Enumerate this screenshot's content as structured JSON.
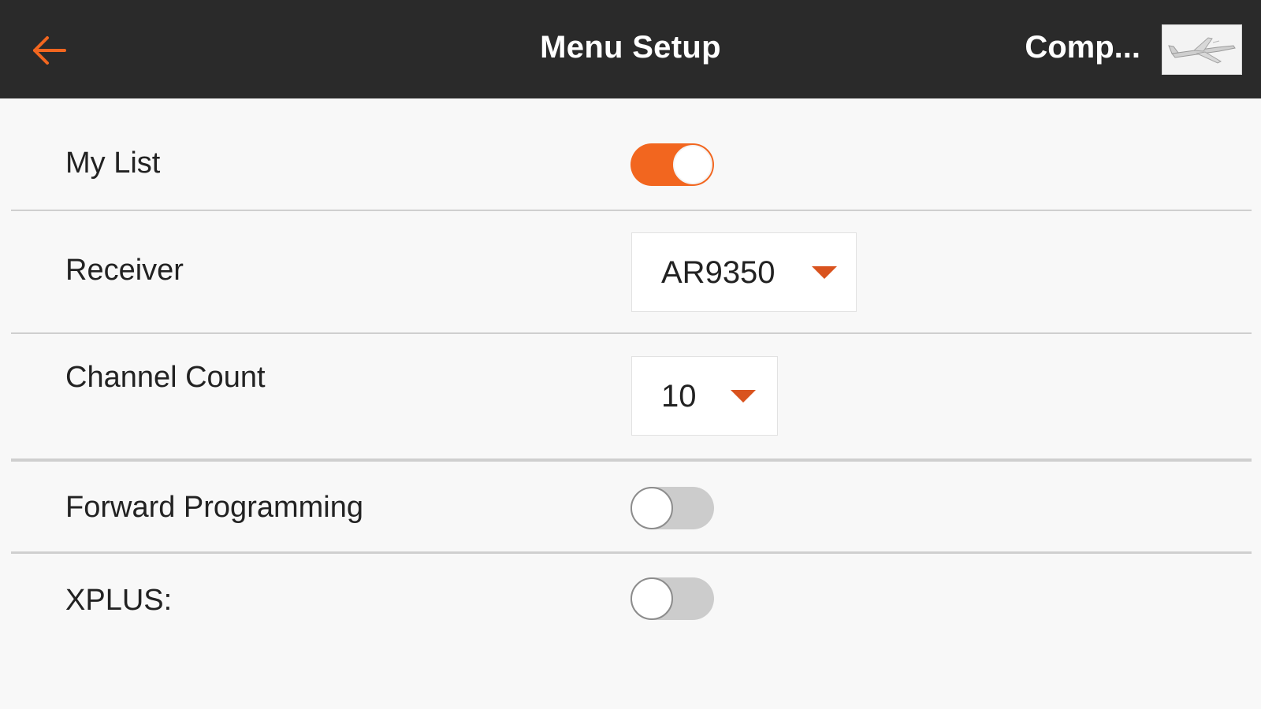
{
  "header": {
    "title": "Menu Setup",
    "model_name": "Comp...",
    "back_icon": "arrow-left-icon",
    "thumbnail_icon": "airplane-thumbnail-icon"
  },
  "colors": {
    "header_bg": "#2a2a2a",
    "accent": "#f2661f",
    "caret": "#d9531e",
    "background": "#f8f8f8"
  },
  "rows": {
    "my_list": {
      "label": "My List",
      "enabled": true
    },
    "receiver": {
      "label": "Receiver",
      "value": "AR9350"
    },
    "channel_count": {
      "label": "Channel Count",
      "value": "10"
    },
    "forward_programming": {
      "label": "Forward Programming",
      "enabled": false
    },
    "xplus": {
      "label": "XPLUS:",
      "enabled": false
    }
  }
}
